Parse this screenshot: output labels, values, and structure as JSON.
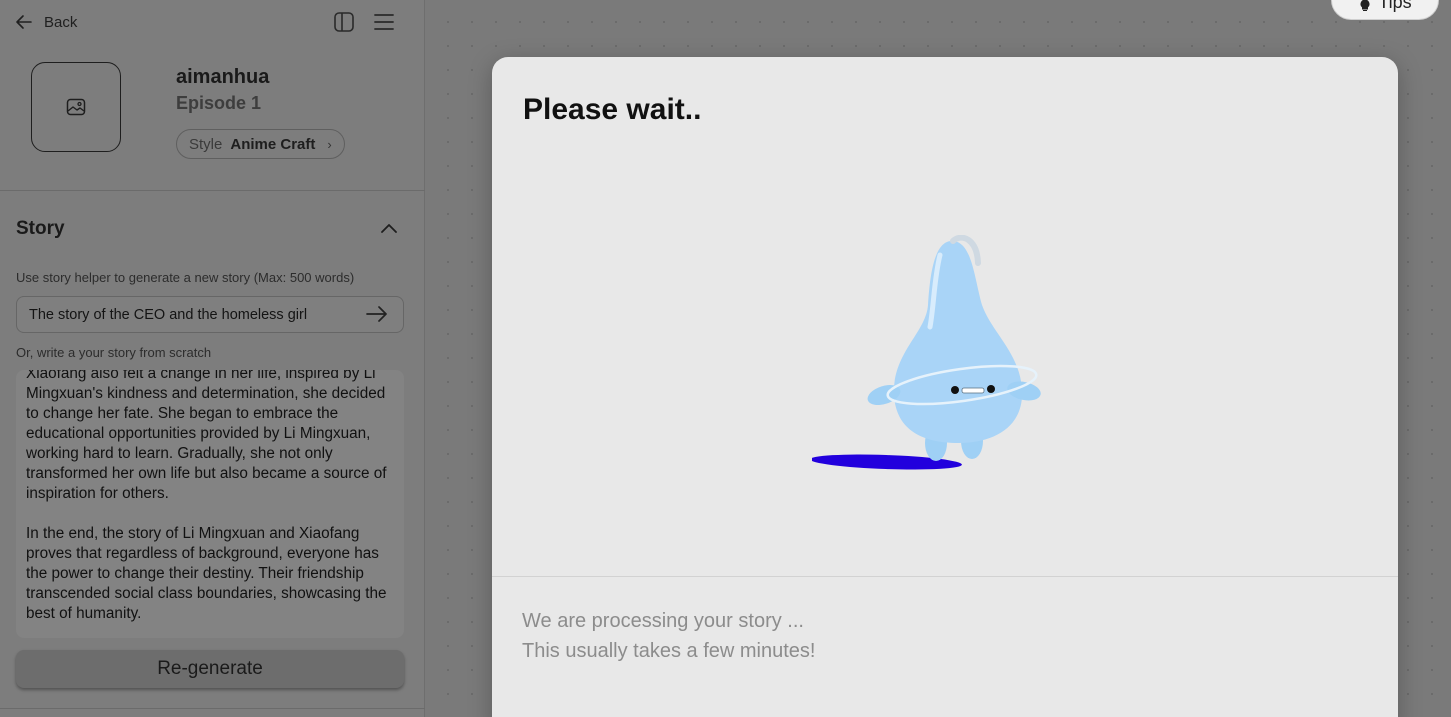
{
  "topbar": {
    "back_label": "Back",
    "icons": [
      "arrow-left-icon",
      "sidebar-layout-icon",
      "hamburger-menu-icon"
    ]
  },
  "project": {
    "title": "aimanhua",
    "episode": "Episode 1",
    "style_label": "Style",
    "style_value": "Anime Craft"
  },
  "story": {
    "heading": "Story",
    "helper_hint": "Use story helper to generate a new story (Max: 500 words)",
    "helper_value": "The story of the CEO and the homeless girl",
    "scratch_hint": "Or, write a your story from scratch",
    "paragraphs": [
      "Xiaofang also felt a change in her life, inspired by Li Mingxuan's kindness and determination, she decided to change her fate. She began to embrace the educational opportunities provided by Li Mingxuan, working hard to learn. Gradually, she not only transformed her own life but also became a source of inspiration for others.",
      "In the end, the story of Li Mingxuan and Xiaofang proves that regardless of background, everyone has the power to change their destiny. Their friendship transcended social class boundaries, showcasing the best of humanity."
    ],
    "regenerate_label": "Re-generate"
  },
  "tips": {
    "label": "Tips"
  },
  "modal": {
    "title": "Please wait..",
    "line1": "We are processing your story ...",
    "line2": "This usually takes a few minutes!"
  },
  "colors": {
    "overlay": "#7a7a7a",
    "modal_bg": "#e8e8e8",
    "mascot_body": "#a9d4f7",
    "mascot_shadow": "#2200dd"
  }
}
